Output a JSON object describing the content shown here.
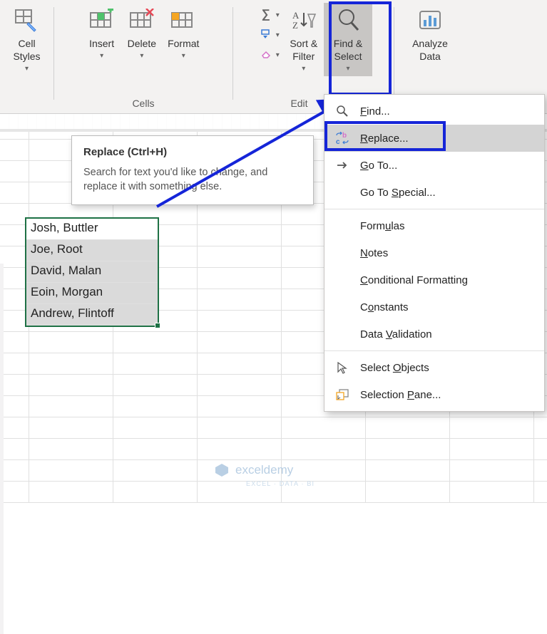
{
  "ribbon": {
    "styles": {
      "cell_styles": "Cell\nStyles"
    },
    "cells_group": {
      "label": "Cells",
      "insert": "Insert",
      "delete": "Delete",
      "format": "Format"
    },
    "editing_group": {
      "label": "Edit",
      "sort_filter": "Sort &\nFilter",
      "find_select": "Find &\nSelect",
      "analyze_data": "Analyze\nData"
    }
  },
  "tooltip": {
    "title": "Replace (Ctrl+H)",
    "body": "Search for text you'd like to change, and replace it with something else."
  },
  "selection_cells": [
    "Josh, Buttler",
    "Joe, Root",
    "David, Malan",
    "Eoin, Morgan",
    "Andrew, Flintoff"
  ],
  "menu": {
    "find": "Find...",
    "replace": "Replace...",
    "go_to": "Go To...",
    "go_to_special": "Go To Special...",
    "formulas": "Formulas",
    "notes": "Notes",
    "conditional_formatting": "Conditional Formatting",
    "constants": "Constants",
    "data_validation": "Data Validation",
    "select_objects": "Select Objects",
    "selection_pane": "Selection Pane..."
  },
  "watermark": {
    "brand": "exceldemy",
    "tag": "EXCEL · DATA · BI"
  }
}
